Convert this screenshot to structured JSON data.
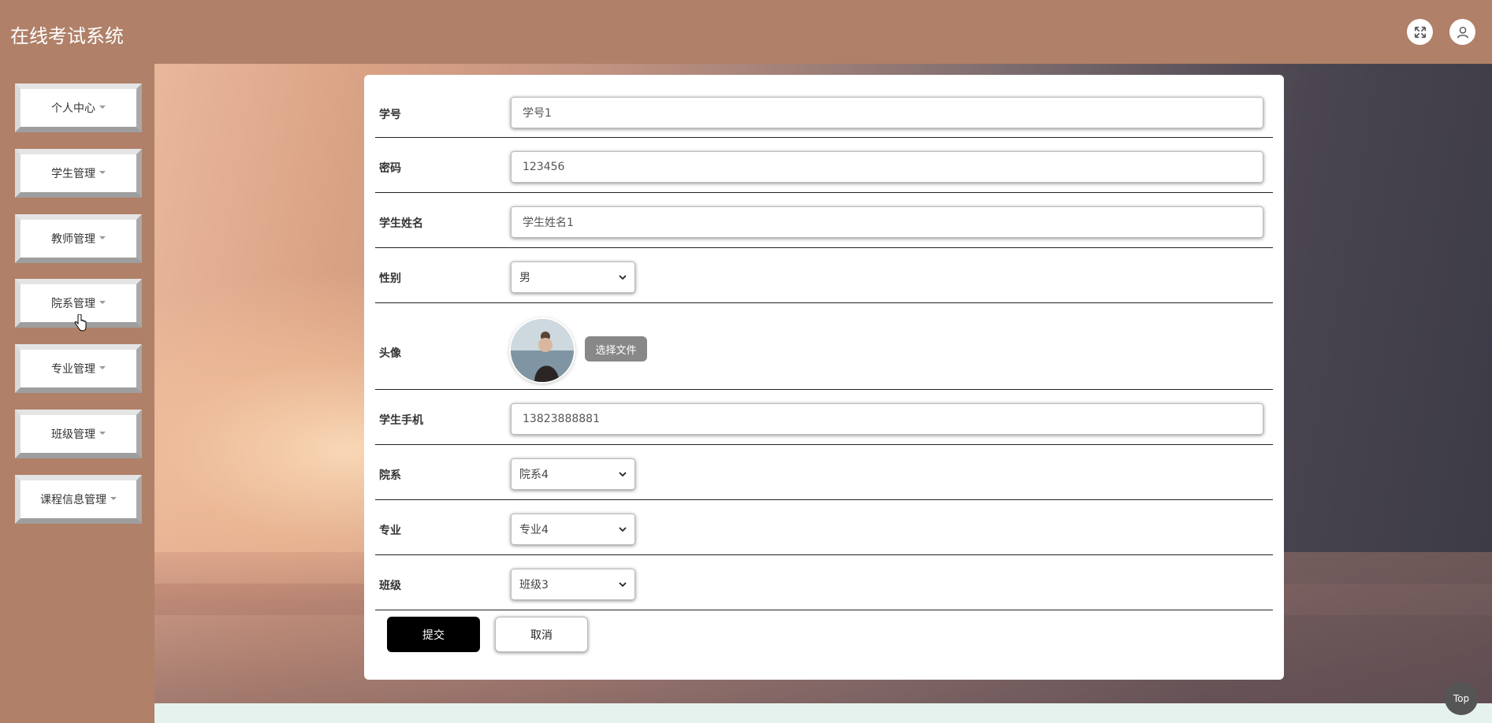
{
  "header": {
    "title": "在线考试系统",
    "fullscreen_icon": "fullscreen-icon",
    "user_icon": "user-icon"
  },
  "sidebar": {
    "items": [
      {
        "label": "个人中心"
      },
      {
        "label": "学生管理"
      },
      {
        "label": "教师管理"
      },
      {
        "label": "院系管理"
      },
      {
        "label": "专业管理"
      },
      {
        "label": "班级管理"
      },
      {
        "label": "课程信息管理"
      }
    ]
  },
  "form": {
    "student_no": {
      "label": "学号",
      "value": "学号1"
    },
    "password": {
      "label": "密码",
      "value": "123456"
    },
    "student_name": {
      "label": "学生姓名",
      "value": "学生姓名1"
    },
    "gender": {
      "label": "性别",
      "value": "男"
    },
    "avatar": {
      "label": "头像",
      "button": "选择文件"
    },
    "phone": {
      "label": "学生手机",
      "value": "13823888881"
    },
    "department": {
      "label": "院系",
      "value": "院系4"
    },
    "major": {
      "label": "专业",
      "value": "专业4"
    },
    "class": {
      "label": "班级",
      "value": "班级3"
    },
    "submit_label": "提交",
    "cancel_label": "取消"
  },
  "back_to_top": "Top",
  "colors": {
    "primary": "#b08068",
    "submit": "#000000",
    "page_bottom": "#e6f2ee"
  }
}
